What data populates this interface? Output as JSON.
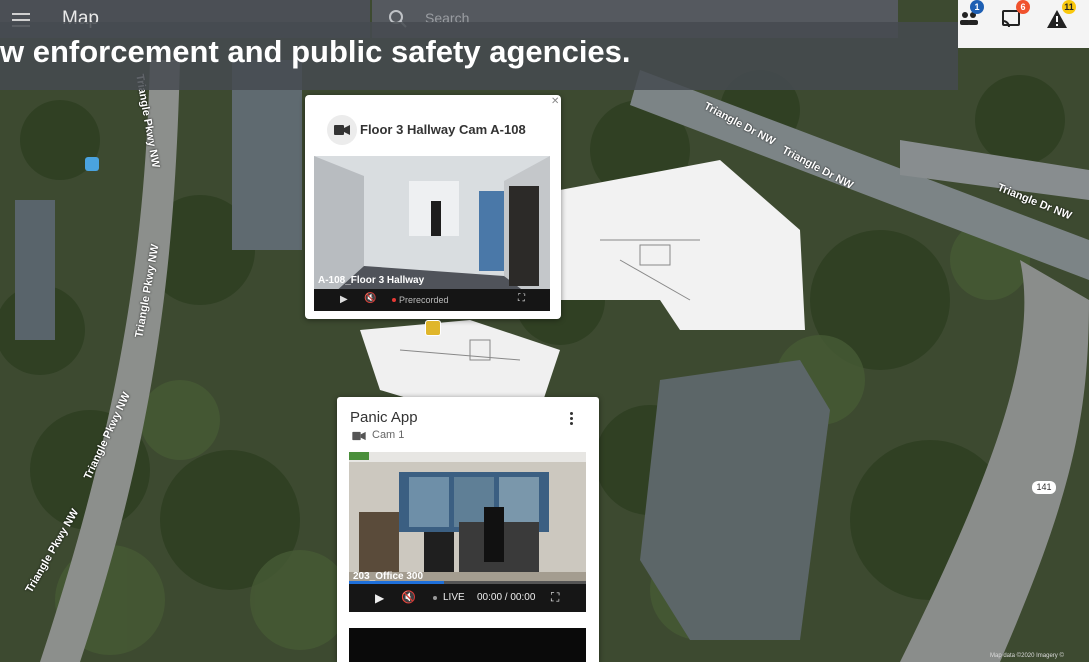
{
  "appbar": {
    "title": "Map"
  },
  "search": {
    "placeholder": "Search"
  },
  "notifications": {
    "people_count": "1",
    "cast_count": "6",
    "alert_count": "11"
  },
  "banner": {
    "text": "w enforcement and public safety agencies."
  },
  "camera_popup": {
    "title": "Floor 3 Hallway Cam A-108",
    "video_label": "A-108_Floor 3 Hallway",
    "status": "Prerecorded"
  },
  "panic_card": {
    "title": "Panic App",
    "subtitle": "Cam 1",
    "video_label": "203_Office 300",
    "live_label": "LIVE",
    "time": "00:00 / 00:00"
  },
  "map": {
    "road_labels": [
      "Triangle Dr NW",
      "Triangle Dr NW",
      "Triangle Dr NW",
      "Triangle Pkwy NW",
      "Triangle Pkwy NW",
      "Triangle Pkwy NW",
      "Triangle Pkwy NW"
    ],
    "route_badge": "141",
    "attribution": "Map data ©2020 Imagery ©"
  },
  "colors": {
    "accent_blue": "#1e6fd9",
    "badge_orange": "#f57c00",
    "badge_yellow": "#f9c80e",
    "live_red": "#e53935"
  }
}
